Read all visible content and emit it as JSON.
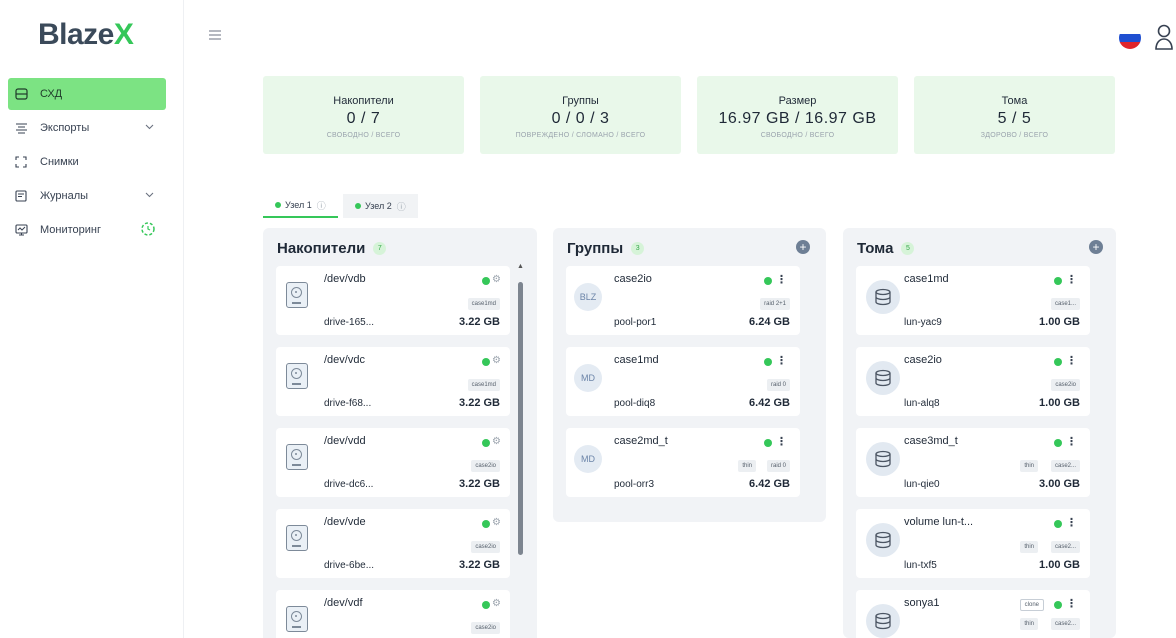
{
  "brand": {
    "name": "Blaze",
    "x": "X"
  },
  "sidebar": {
    "items": [
      {
        "label": "СХД",
        "icon": "storage-icon",
        "active": true
      },
      {
        "label": "Экспорты",
        "icon": "export-icon",
        "chevron": true
      },
      {
        "label": "Снимки",
        "icon": "snapshot-icon"
      },
      {
        "label": "Журналы",
        "icon": "log-icon",
        "chevron": true
      },
      {
        "label": "Мониторинг",
        "icon": "monitor-icon",
        "spinner": true
      }
    ]
  },
  "stats": [
    {
      "title": "Накопители",
      "value": "0 / 7",
      "sub": "СВОБОДНО / ВСЕГО"
    },
    {
      "title": "Группы",
      "value": "0 / 0 / 3",
      "sub": "ПОВРЕЖДЕНО / СЛОМАНО / ВСЕГО"
    },
    {
      "title": "Размер",
      "value": "16.97 GB / 16.97 GB",
      "sub": "СВОБОДНО / ВСЕГО"
    },
    {
      "title": "Тома",
      "value": "5 / 5",
      "sub": "ЗДОРОВО / ВСЕГО"
    }
  ],
  "nodes": [
    {
      "label": "Узел 1"
    },
    {
      "label": "Узел 2"
    }
  ],
  "drives": {
    "title": "Накопители",
    "count": "7",
    "items": [
      {
        "name": "/dev/vdb",
        "tag": "case1md",
        "id": "drive-165...",
        "size": "3.22 GB"
      },
      {
        "name": "/dev/vdc",
        "tag": "case1md",
        "id": "drive-f68...",
        "size": "3.22 GB"
      },
      {
        "name": "/dev/vdd",
        "tag": "case2io",
        "id": "drive-dc6...",
        "size": "3.22 GB"
      },
      {
        "name": "/dev/vde",
        "tag": "case2io",
        "id": "drive-6be...",
        "size": "3.22 GB"
      },
      {
        "name": "/dev/vdf",
        "tag": "case2io",
        "id": "",
        "size": ""
      }
    ]
  },
  "groups": {
    "title": "Группы",
    "count": "3",
    "items": [
      {
        "avatar": "BLZ",
        "name": "case2io",
        "tags": [
          "raid 2+1"
        ],
        "pool": "pool-por1",
        "size": "6.24 GB"
      },
      {
        "avatar": "MD",
        "name": "case1md",
        "tags": [
          "raid 0"
        ],
        "pool": "pool-diq8",
        "size": "6.42 GB"
      },
      {
        "avatar": "MD",
        "name": "case2md_t",
        "tags": [
          "thin",
          "raid 0"
        ],
        "pool": "pool-orr3",
        "size": "6.42 GB"
      }
    ]
  },
  "volumes": {
    "title": "Тома",
    "count": "5",
    "items": [
      {
        "name": "case1md",
        "tags": [
          "case1..."
        ],
        "lun": "lun-yac9",
        "size": "1.00 GB"
      },
      {
        "name": "case2io",
        "tags": [
          "case2io"
        ],
        "lun": "lun-alq8",
        "size": "1.00 GB"
      },
      {
        "name": "case3md_t",
        "tags": [
          "thin",
          "case2..."
        ],
        "lun": "lun-qie0",
        "size": "3.00 GB"
      },
      {
        "name": "volume lun-t...",
        "tags": [
          "thin",
          "case2..."
        ],
        "lun": "lun-txf5",
        "size": "1.00 GB"
      },
      {
        "name": "sonya1",
        "clone": "clone",
        "tags": [
          "thin",
          "case2..."
        ],
        "lun": "",
        "size": ""
      }
    ]
  },
  "colors": {
    "accent": "#35c759",
    "active_nav": "#7ce383",
    "stat_bg": "#e9f8ea",
    "column_bg": "#f1f3f6"
  }
}
